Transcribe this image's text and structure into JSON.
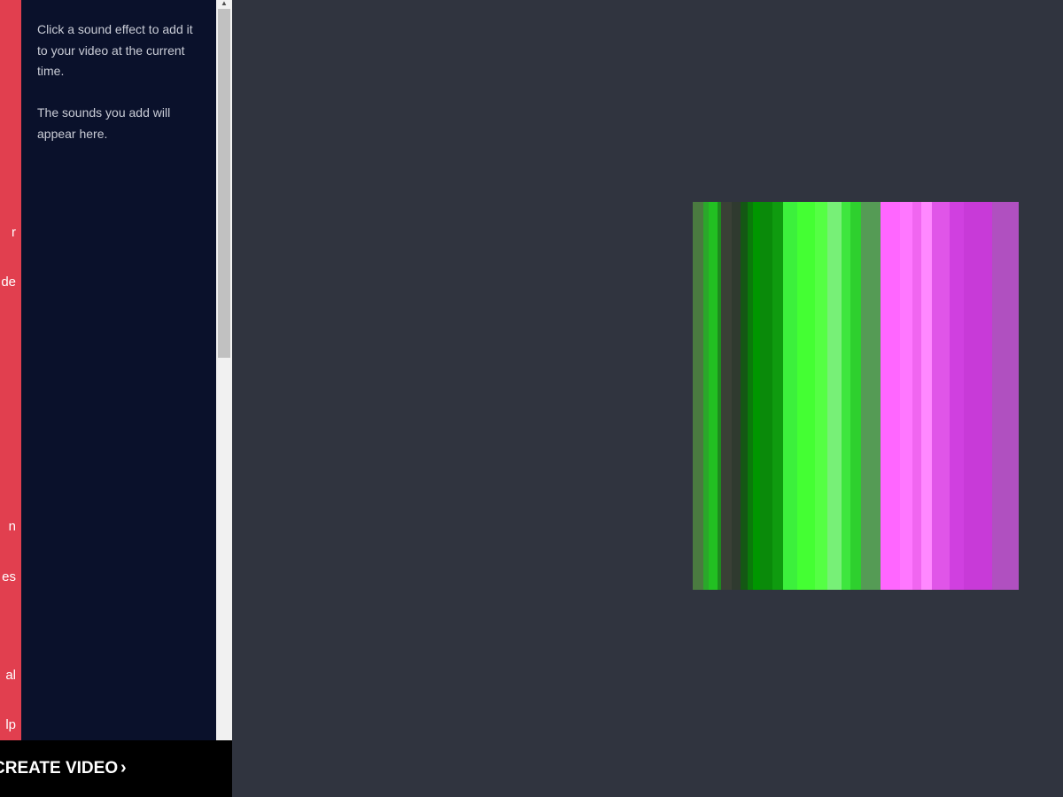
{
  "category_rail": {
    "items": [
      "r",
      "de",
      "",
      "",
      "n",
      "es",
      "al",
      "lp"
    ]
  },
  "sfx_panel": {
    "instruction": "Click a sound effect to add it to your video at the current time.",
    "empty_message": "The sounds you add will appear here."
  },
  "scrollbar": {
    "up_arrow": "▲"
  },
  "footer": {
    "create_label": "CREATE VIDEO",
    "chevron": "›"
  },
  "colors": {
    "rail": "#e13f4f",
    "panel": "#0a112b",
    "preview_bg": "#30343f",
    "footer": "#000000"
  },
  "video_stripes": [
    {
      "color": "#4a7a40"
    },
    {
      "color": "#2aa82a"
    },
    {
      "color": "#22c022"
    },
    {
      "color": "#1e8a1e"
    },
    {
      "color": "#3a4036"
    },
    {
      "color": "#2f3a2f"
    },
    {
      "color": "#145814"
    },
    {
      "color": "#0a7a0a"
    },
    {
      "color": "#009600"
    },
    {
      "color": "#0a8a0a"
    },
    {
      "color": "#0f9b0f"
    },
    {
      "color": "#3cf03c"
    },
    {
      "color": "#44ff33"
    },
    {
      "color": "#55ff44"
    },
    {
      "color": "#77f077"
    },
    {
      "color": "#3ee63e"
    },
    {
      "color": "#2ed02e"
    },
    {
      "color": "#559b55"
    },
    {
      "color": "#ff66ff"
    },
    {
      "color": "#ff77ff"
    },
    {
      "color": "#f066f0"
    },
    {
      "color": "#ff88ff"
    },
    {
      "color": "#e055e8"
    },
    {
      "color": "#d040e0"
    },
    {
      "color": "#c83ad8"
    },
    {
      "color": "#b050c0"
    }
  ]
}
